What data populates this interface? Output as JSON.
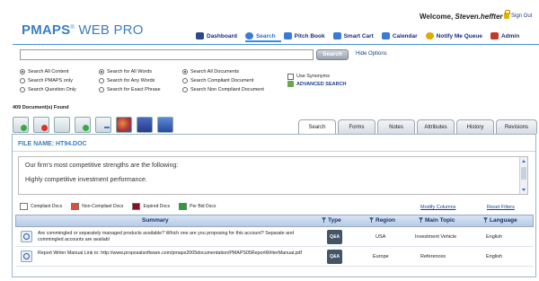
{
  "header": {
    "logo_main": "PMAPS",
    "logo_reg": "®",
    "logo_sub": "WEB PRO",
    "welcome_prefix": "Welcome, ",
    "user": "Steven.heffter",
    "signout": "Sign Out"
  },
  "nav": [
    {
      "label": "Dashboard",
      "icon": "dashboard-icon",
      "color": "#2a4a8a"
    },
    {
      "label": "Search",
      "icon": "search-icon",
      "color": "#3a7ad8"
    },
    {
      "label": "Pitch Book",
      "icon": "book-icon",
      "color": "#3a7ad8"
    },
    {
      "label": "Smart Cart",
      "icon": "cart-icon",
      "color": "#3a7ad8"
    },
    {
      "label": "Calendar",
      "icon": "calendar-icon",
      "color": "#3a7ad8"
    },
    {
      "label": "Notify Me Queue",
      "icon": "bell-icon",
      "color": "#e0a800"
    },
    {
      "label": "Admin",
      "icon": "admin-icon",
      "color": "#c03a2a"
    }
  ],
  "search": {
    "value": "",
    "button": "Search",
    "hide_options": "Hide Options"
  },
  "options": {
    "col1": [
      "Search All Content",
      "Search PMAPS only",
      "Search Question Only"
    ],
    "col2": [
      "Search for All Words",
      "Search for Any Words",
      "Search for Exact Phrase"
    ],
    "col3": [
      "Search All Documents",
      "Search Compliant Document",
      "Search Non Compliant Document"
    ],
    "synonyms": "Use Synonyms",
    "advanced": "ADVANCED SEARCH"
  },
  "doc_count": "409 Document(s) Found",
  "tabs": [
    "Search",
    "Forms",
    "Notes",
    "Attributes",
    "History",
    "Revisions"
  ],
  "panel": {
    "file_name": "FILE NAME: HT94.DOC",
    "text_line1": "Our firm's most competitive strengths are the following:",
    "text_line2": "Highly competitive investment performance."
  },
  "legend": [
    {
      "label": "Compliant Docs",
      "color": "#ffffff"
    },
    {
      "label": "Non-Compliant Docs",
      "color": "#d9533a"
    },
    {
      "label": "Expired Docs",
      "color": "#8b1020"
    },
    {
      "label": "Per Bid Docs",
      "color": "#2e9a3a"
    }
  ],
  "links": {
    "modify_columns": "Modify Columns",
    "reset_filters": "Reset Filters"
  },
  "table": {
    "headers": {
      "summary": "Summary",
      "type": "Type",
      "region": "Region",
      "topic": "Main Topic",
      "language": "Language"
    },
    "rows": [
      {
        "summary": "Are commingled or separately managed products available? Which one are you proposing for this account? Separate and commingled accounts are availabl",
        "type": "Q&A",
        "region": "USA",
        "topic": "Investment Vehicle",
        "language": "English"
      },
      {
        "summary": "Report Writer Manual Link to: http://www.proposalsoftware.com/pmaps2005documentation/PMAPS05ReportWriterManual.pdf",
        "type": "Q&A",
        "region": "Europe",
        "topic": "References",
        "language": "English"
      }
    ]
  }
}
